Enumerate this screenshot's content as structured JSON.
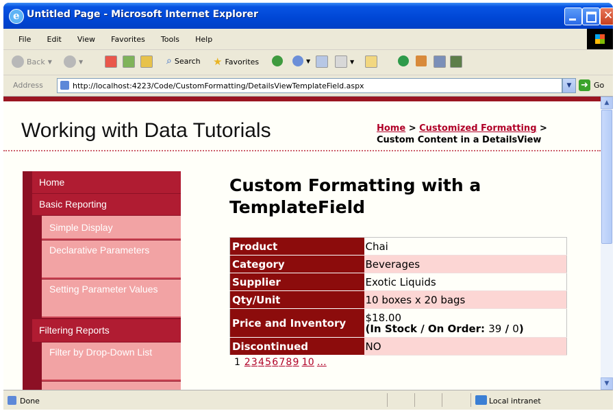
{
  "window": {
    "title": "Untitled Page - Microsoft Internet Explorer"
  },
  "menubar": {
    "items": [
      "File",
      "Edit",
      "View",
      "Favorites",
      "Tools",
      "Help"
    ]
  },
  "toolbar": {
    "back_label": "Back",
    "search_label": "Search",
    "favorites_label": "Favorites"
  },
  "address": {
    "label": "Address",
    "url": "http://localhost:4223/Code/CustomFormatting/DetailsViewTemplateField.aspx",
    "go_label": "Go"
  },
  "site": {
    "title": "Working with Data Tutorials",
    "breadcrumb": {
      "home": "Home",
      "sep1": " > ",
      "section": "Customized Formatting",
      "sep2": " >",
      "current": "Custom Content in a DetailsView"
    }
  },
  "sidebar": {
    "items": [
      {
        "label": "Home",
        "level": "top"
      },
      {
        "label": "Basic Reporting",
        "level": "top"
      },
      {
        "label": "Simple Display",
        "level": "sub"
      },
      {
        "label": "Declarative Parameters",
        "level": "sub"
      },
      {
        "label": "Setting Parameter Values",
        "level": "sub"
      },
      {
        "label": "Filtering Reports",
        "level": "top"
      },
      {
        "label": "Filter by Drop-Down List",
        "level": "sub"
      }
    ]
  },
  "main": {
    "heading": "Custom Formatting with a TemplateField",
    "details": [
      {
        "field": "Product",
        "value": "Chai"
      },
      {
        "field": "Category",
        "value": "Beverages"
      },
      {
        "field": "Supplier",
        "value": "Exotic Liquids"
      },
      {
        "field": "Qty/Unit",
        "value": "10 boxes x 20 bags"
      },
      {
        "field": "Price and Inventory",
        "price": "$18.00",
        "stock_prefix": "(In Stock / On Order: ",
        "in_stock": "39",
        "slash": " / ",
        "on_order": "0",
        "stock_suffix": ")"
      },
      {
        "field": "Discontinued",
        "value": "NO"
      }
    ],
    "pager": {
      "current": "1",
      "pages": [
        "2",
        "3",
        "4",
        "5",
        "6",
        "7",
        "8",
        "9",
        "10",
        "..."
      ]
    }
  },
  "statusbar": {
    "status": "Done",
    "zone": "Local intranet"
  }
}
